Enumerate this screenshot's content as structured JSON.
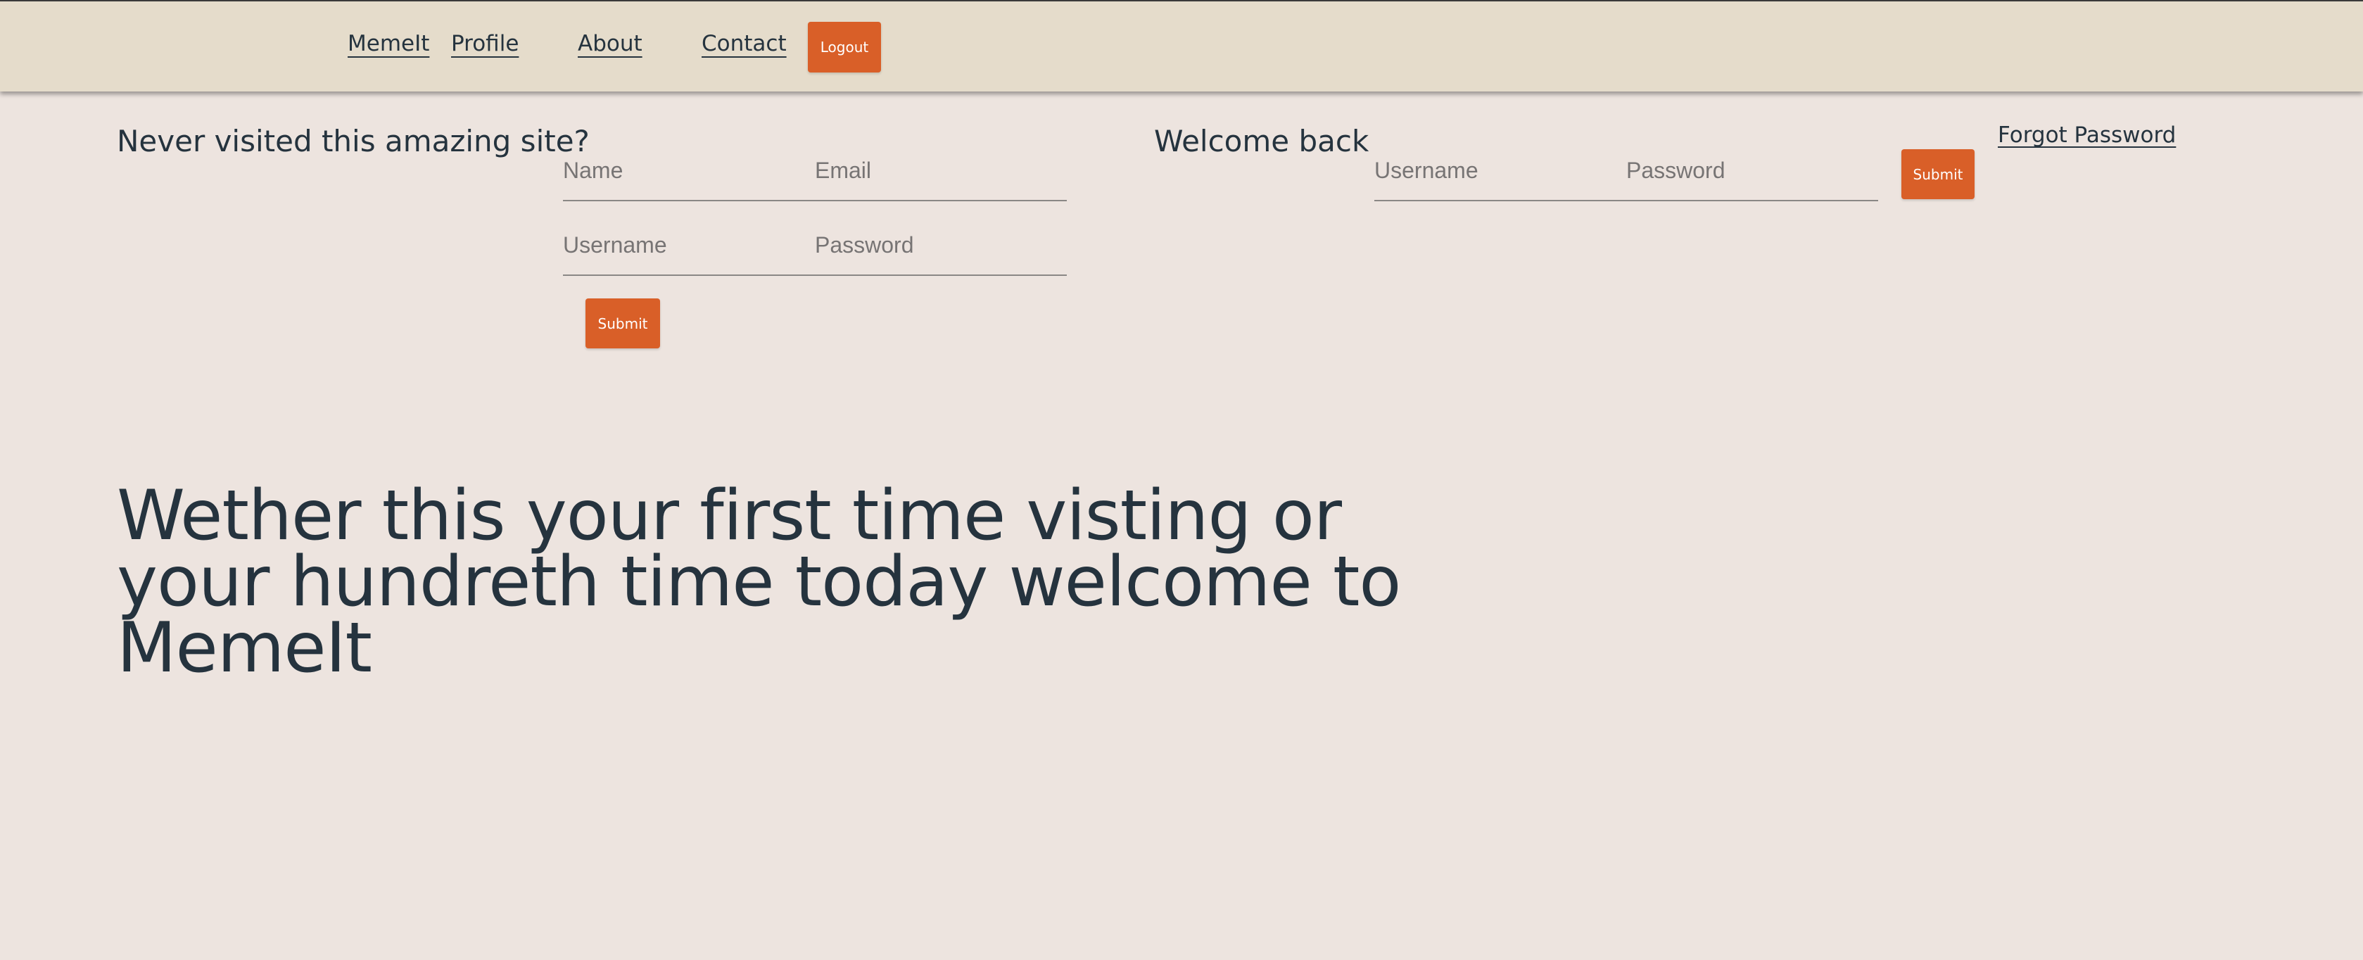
{
  "nav": {
    "links": [
      "MemeIt",
      "Profile",
      "About",
      "Contact"
    ],
    "logout_label": "Logout"
  },
  "signup": {
    "heading": "Never visited this amazing site?",
    "name_placeholder": "Name",
    "email_placeholder": "Email",
    "username_placeholder": "Username",
    "password_placeholder": "Password",
    "submit_label": "Submit"
  },
  "login": {
    "heading": "Welcome back",
    "username_placeholder": "Username",
    "password_placeholder": "Password",
    "submit_label": "Submit",
    "forgot_label": "Forgot Password"
  },
  "hero": {
    "text": "Wether this your first time visting or your hundreth time today welcome to MemeIt"
  },
  "colors": {
    "page_bg": "#ede4df",
    "navbar_bg": "#e5dccb",
    "accent": "#d95f28",
    "text": "#25333e"
  }
}
